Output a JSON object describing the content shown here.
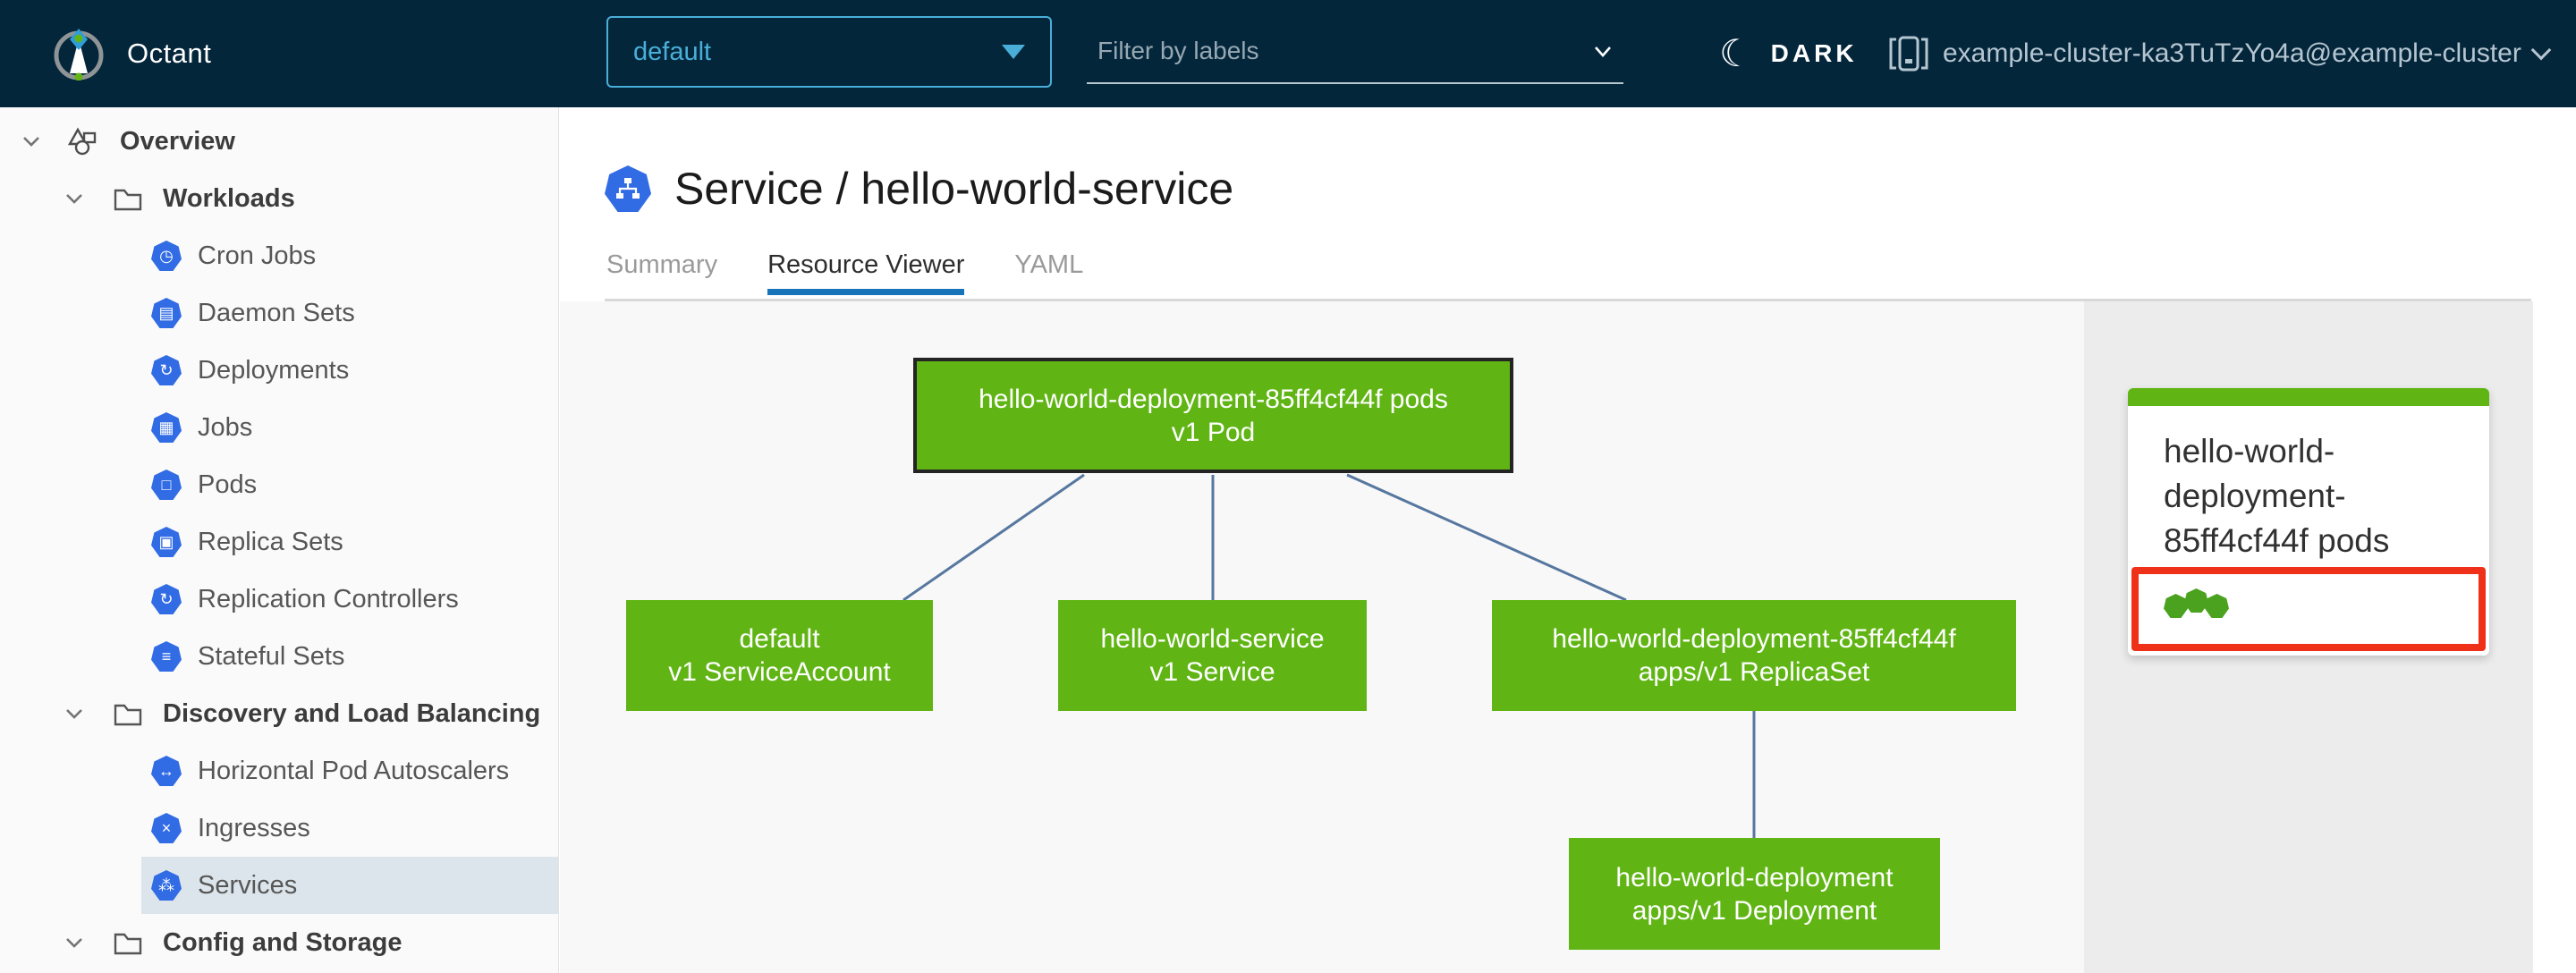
{
  "header": {
    "app_title": "Octant",
    "namespace_selector": {
      "value": "default"
    },
    "filter": {
      "placeholder": "Filter by labels"
    },
    "theme_toggle": {
      "label": "DARK",
      "icon": "moon"
    },
    "context_selector": {
      "label": "example-cluster-ka3TuTzYo4a@example-cluster"
    }
  },
  "sidebar": {
    "items": [
      {
        "label": "Overview",
        "type": "root-group",
        "expanded": true
      },
      {
        "label": "Workloads",
        "type": "group",
        "expanded": true
      },
      {
        "label": "Cron Jobs",
        "type": "leaf",
        "glyph": "◷"
      },
      {
        "label": "Daemon Sets",
        "type": "leaf",
        "glyph": "▤"
      },
      {
        "label": "Deployments",
        "type": "leaf",
        "glyph": "↻"
      },
      {
        "label": "Jobs",
        "type": "leaf",
        "glyph": "▦"
      },
      {
        "label": "Pods",
        "type": "leaf",
        "glyph": "□"
      },
      {
        "label": "Replica Sets",
        "type": "leaf",
        "glyph": "▣"
      },
      {
        "label": "Replication Controllers",
        "type": "leaf",
        "glyph": "↻"
      },
      {
        "label": "Stateful Sets",
        "type": "leaf",
        "glyph": "≡"
      },
      {
        "label": "Discovery and Load Balancing",
        "type": "group",
        "expanded": true
      },
      {
        "label": "Horizontal Pod Autoscalers",
        "type": "leaf",
        "glyph": "↔"
      },
      {
        "label": "Ingresses",
        "type": "leaf",
        "glyph": "×"
      },
      {
        "label": "Services",
        "type": "leaf",
        "glyph": "⁂",
        "selected": true
      },
      {
        "label": "Config and Storage",
        "type": "group",
        "expanded": true
      }
    ]
  },
  "main": {
    "title": "Service / hello-world-service",
    "tabs": [
      {
        "label": "Summary",
        "active": false
      },
      {
        "label": "Resource Viewer",
        "active": true
      },
      {
        "label": "YAML",
        "active": false
      }
    ]
  },
  "graph": {
    "nodes": [
      {
        "name": "hello-world-deployment-85ff4cf44f pods",
        "kind": "v1 Pod",
        "selected": true
      },
      {
        "name": "default",
        "kind": "v1 ServiceAccount",
        "selected": false
      },
      {
        "name": "hello-world-service",
        "kind": "v1 Service",
        "selected": false
      },
      {
        "name": "hello-world-deployment-85ff4cf44f",
        "kind": "apps/v1 ReplicaSet",
        "selected": false
      },
      {
        "name": "hello-world-deployment",
        "kind": "apps/v1 Deployment",
        "selected": false
      }
    ]
  },
  "panel": {
    "card": {
      "title": "hello-world-deployment-85ff4cf44f pods",
      "status_dots": 3
    }
  },
  "colors": {
    "header_bg": "#04263b",
    "accent_blue": "#49afd9",
    "tab_underline": "#1774b8",
    "k8s_icon_blue": "#326ce5",
    "node_green": "#60b515",
    "status_dot_green": "#4ba21f",
    "highlight_red": "#ee3118",
    "edge_blue": "#56779f",
    "selected_nav_bg": "#dce5eb",
    "panel_bg": "#ececec"
  }
}
